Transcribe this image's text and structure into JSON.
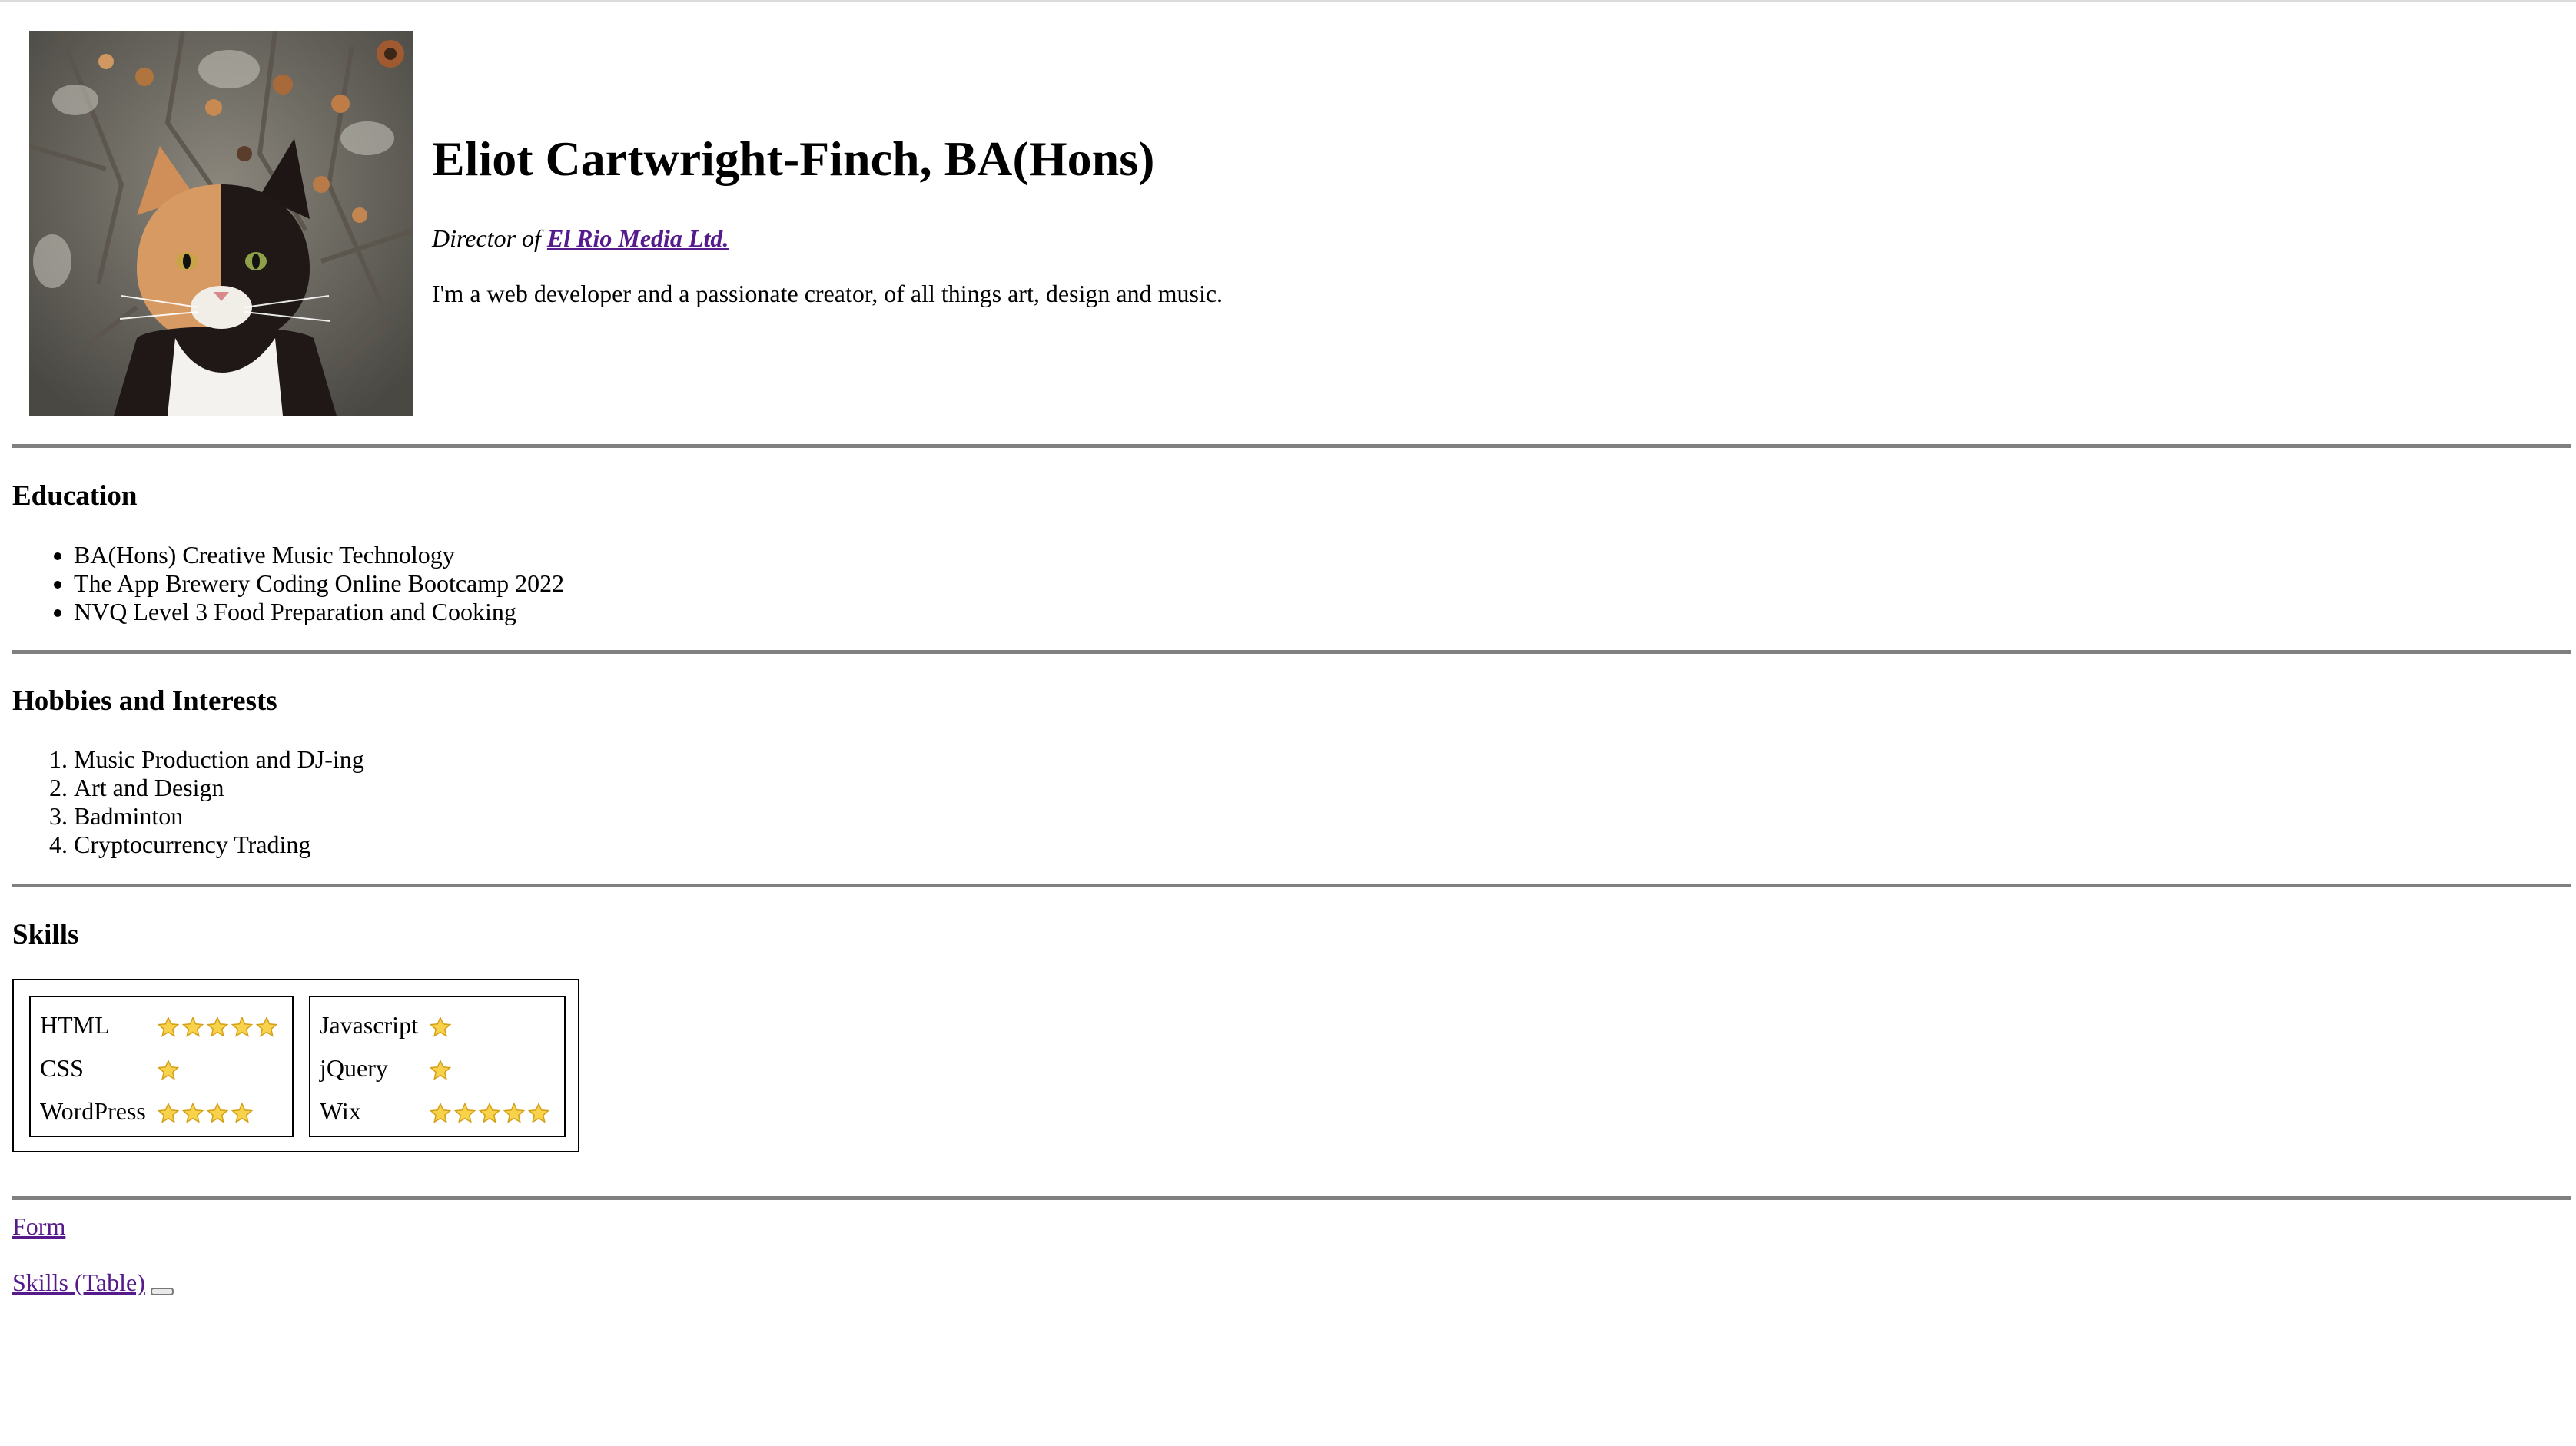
{
  "profile": {
    "name": "Eliot Cartwright-Finch, BA(Hons)",
    "role_prefix": "Director of",
    "company": "El Rio Media Ltd.",
    "intro": "I'm a web developer and a passionate creator, of all things art, design and music."
  },
  "education": {
    "heading": "Education",
    "items": [
      "BA(Hons) Creative Music Technology",
      "The App Brewery Coding Online Bootcamp 2022",
      "NVQ Level 3 Food Preparation and Cooking"
    ]
  },
  "hobbies": {
    "heading": "Hobbies and Interests",
    "items": [
      "Music Production and DJ-ing",
      "Art and Design",
      "Badminton",
      "Cryptocurrency Trading"
    ]
  },
  "skills": {
    "heading": "Skills",
    "left": [
      {
        "name": "HTML",
        "stars": 5
      },
      {
        "name": "CSS",
        "stars": 1
      },
      {
        "name": "WordPress",
        "stars": 4
      }
    ],
    "right": [
      {
        "name": "Javascript",
        "stars": 1
      },
      {
        "name": "jQuery",
        "stars": 1
      },
      {
        "name": "Wix",
        "stars": 5
      }
    ]
  },
  "links": {
    "form": "Form",
    "skills_table": "Skills (Table)"
  },
  "colors": {
    "link_visited": "#551a8b",
    "rule": "#808080",
    "star_fill": "#f7d24a",
    "star_stroke": "#d4a017"
  }
}
